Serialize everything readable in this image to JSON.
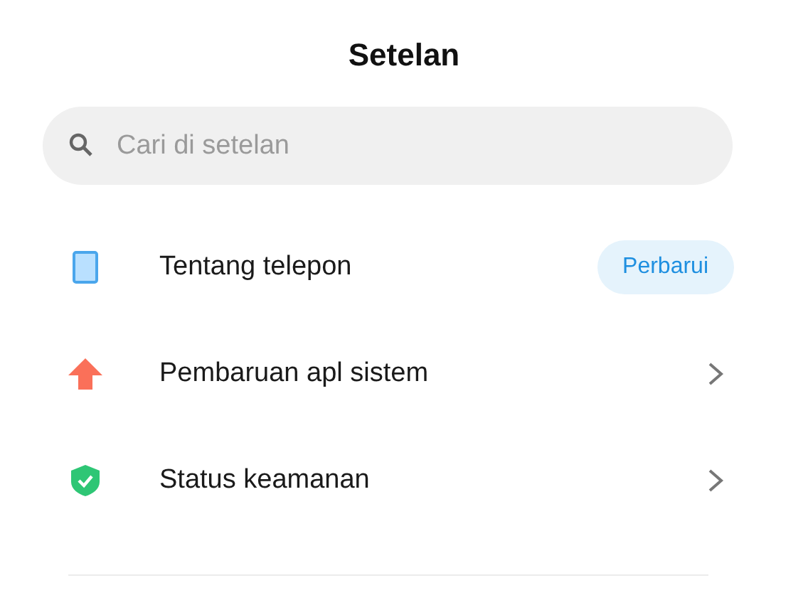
{
  "title": "Setelan",
  "search": {
    "placeholder": "Cari di setelan"
  },
  "items": [
    {
      "label": "Tentang telepon",
      "kind": "badge",
      "badge": "Perbarui"
    },
    {
      "label": "Pembaruan apl sistem",
      "kind": "chevron"
    },
    {
      "label": "Status keamanan",
      "kind": "chevron"
    }
  ]
}
